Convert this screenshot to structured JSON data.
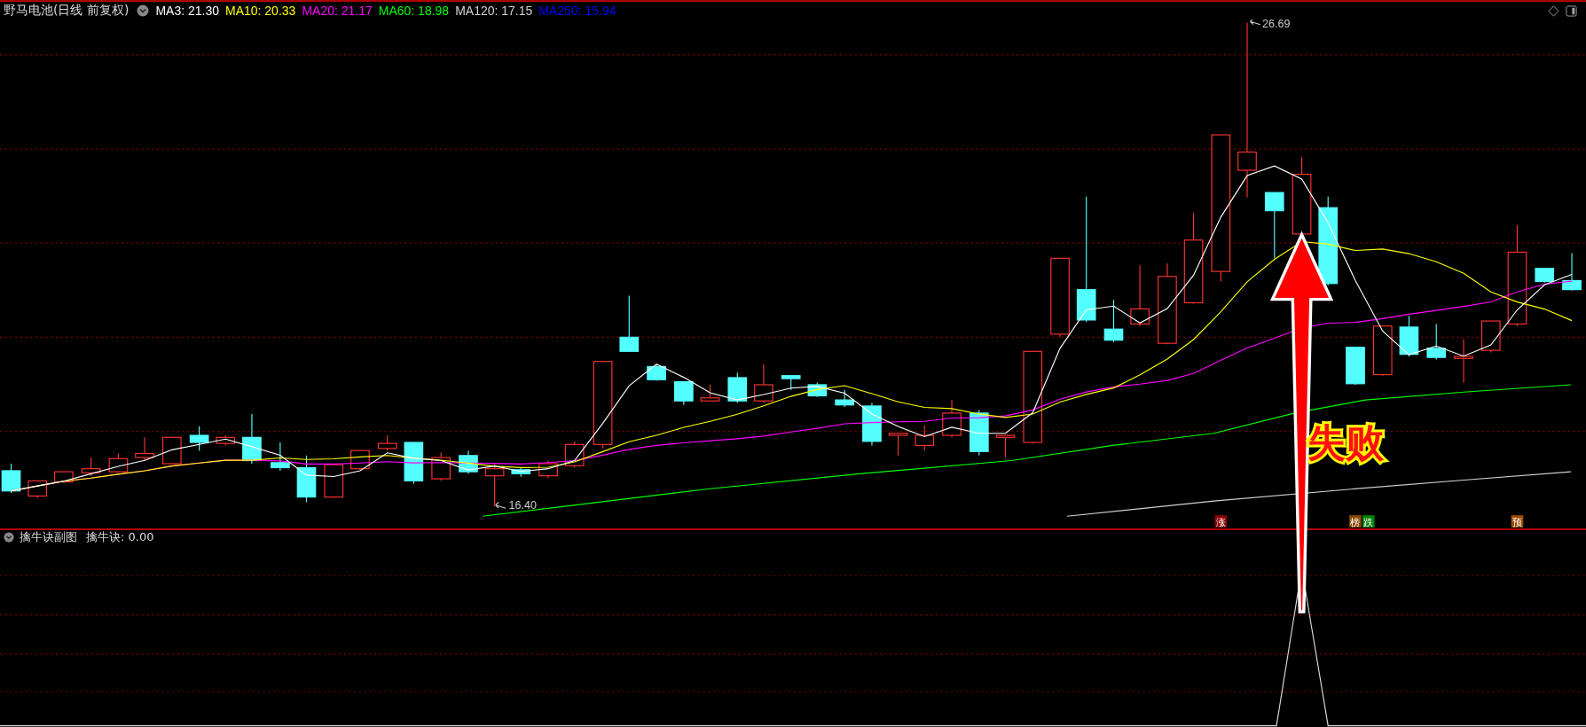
{
  "main_panel": {
    "title": "野马电池(日线 前复权)",
    "ma_lines": [
      {
        "label": "MA3: 21.30",
        "color": "#ffffff"
      },
      {
        "label": "MA10: 20.33",
        "color": "#ffff00"
      },
      {
        "label": "MA20: 21.17",
        "color": "#ff00ff"
      },
      {
        "label": "MA60: 18.98",
        "color": "#00ff00"
      },
      {
        "label": "MA120: 17.15",
        "color": "#d0d0d0"
      },
      {
        "label": "MA250: 15.94",
        "color": "#0000ff"
      }
    ],
    "high_label": "26.69",
    "low_label": "16.40",
    "markers": [
      {
        "label": "涨",
        "color": "#8b0000"
      },
      {
        "label": "榜",
        "color": "#8b4a00"
      },
      {
        "label": "跌",
        "color": "#008000"
      },
      {
        "label": "预",
        "color": "#9a4a00"
      }
    ],
    "annotation": "失败"
  },
  "sub_panel": {
    "title": "擒牛诀副图",
    "indicator": "擒牛诀: 0.00"
  }
}
